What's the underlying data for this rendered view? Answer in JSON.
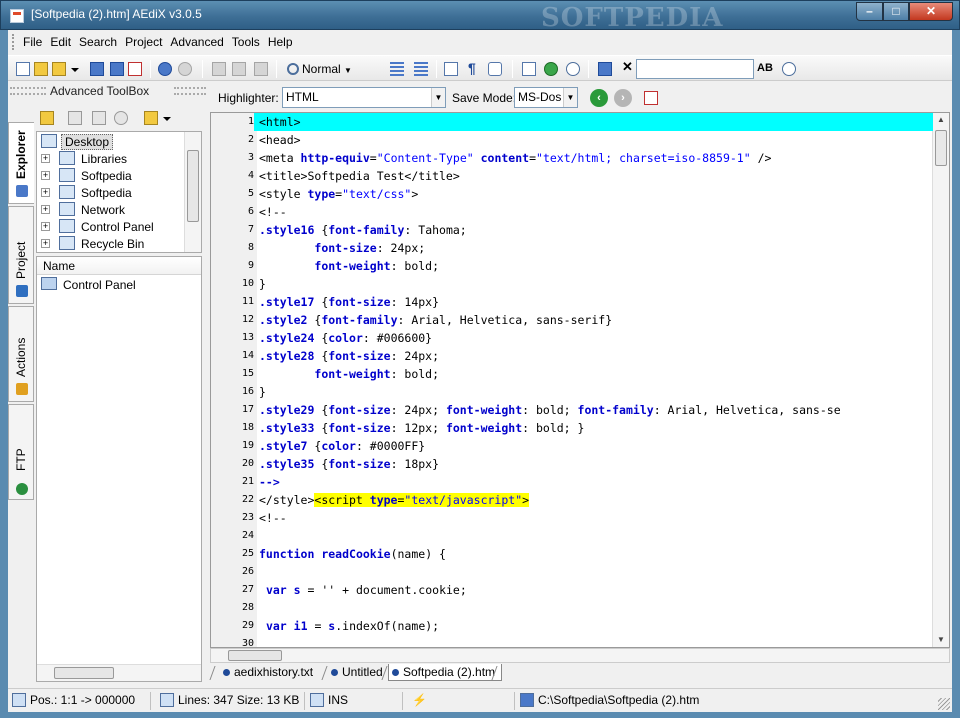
{
  "window": {
    "title": "[Softpedia (2).htm] AEdiX v3.0.5",
    "watermark": "SOFTPEDIA",
    "min_glyph": "–",
    "max_glyph": "□",
    "close_glyph": "✕"
  },
  "menu": [
    "File",
    "Edit",
    "Search",
    "Project",
    "Advanced",
    "Tools",
    "Help"
  ],
  "toolbar": {
    "zoom_label": "Normal",
    "close_glyph": "✕",
    "find_value": "",
    "ab_label": "AB"
  },
  "toolbox": {
    "title": "Advanced ToolBox",
    "tabs": [
      "Explorer",
      "Project",
      "Actions",
      "FTP"
    ],
    "tree": [
      {
        "label": "Desktop",
        "expander": ""
      },
      {
        "label": "Libraries",
        "expander": "+"
      },
      {
        "label": "Softpedia",
        "expander": "+"
      },
      {
        "label": "Softpedia",
        "expander": "+"
      },
      {
        "label": "Network",
        "expander": "+"
      },
      {
        "label": "Control Panel",
        "expander": "+"
      },
      {
        "label": "Recycle Bin",
        "expander": "+"
      }
    ],
    "list_header": "Name",
    "list_items": [
      "Control Panel"
    ]
  },
  "options": {
    "highlighter_label": "Highlighter:",
    "highlighter_value": "HTML",
    "save_mode_label": "Save Mode:",
    "save_mode_value": "MS-Dos"
  },
  "editor": {
    "lines": [
      {
        "n": "1",
        "html": "&lt;html&gt;",
        "current": true
      },
      {
        "n": "2",
        "html": "&lt;head&gt;"
      },
      {
        "n": "3",
        "html": "&lt;meta <span class=\"kw\">http-equiv</span>=<span class=\"str\">\"Content-Type\"</span> <span class=\"kw\">content</span>=<span class=\"str\">\"text/html; charset=iso-8859-1\"</span> /&gt;"
      },
      {
        "n": "4",
        "html": "&lt;title&gt;Softpedia Test&lt;/title&gt;"
      },
      {
        "n": "5",
        "html": "&lt;style <span class=\"kw\">type</span>=<span class=\"str\">\"text/css\"</span>&gt;"
      },
      {
        "n": "6",
        "html": "&lt;!--"
      },
      {
        "n": "7",
        "html": "<span class=\"kw\">.style16</span> {<span class=\"kw\">font-family</span>: Tahoma;"
      },
      {
        "n": "8",
        "html": "        <span class=\"kw\">font-size</span>: 24px;"
      },
      {
        "n": "9",
        "html": "        <span class=\"kw\">font-weight</span>: bold;"
      },
      {
        "n": "10",
        "html": "}"
      },
      {
        "n": "11",
        "html": "<span class=\"kw\">.style17</span> {<span class=\"kw\">font-size</span>: 14px}"
      },
      {
        "n": "12",
        "html": "<span class=\"kw\">.style2</span> {<span class=\"kw\">font-family</span>: Arial, Helvetica, sans-serif}"
      },
      {
        "n": "13",
        "html": "<span class=\"kw\">.style24</span> {<span class=\"kw\">color</span>: #006600}"
      },
      {
        "n": "14",
        "html": "<span class=\"kw\">.style28</span> {<span class=\"kw\">font-size</span>: 24px;"
      },
      {
        "n": "15",
        "html": "        <span class=\"kw\">font-weight</span>: bold;"
      },
      {
        "n": "16",
        "html": "}"
      },
      {
        "n": "17",
        "html": "<span class=\"kw\">.style29</span> {<span class=\"kw\">font-size</span>: 24px; <span class=\"kw\">font-weight</span>: bold; <span class=\"kw\">font-family</span>: Arial, Helvetica, sans-se"
      },
      {
        "n": "18",
        "html": "<span class=\"kw\">.style33</span> {<span class=\"kw\">font-size</span>: 12px; <span class=\"kw\">font-weight</span>: bold; }"
      },
      {
        "n": "19",
        "html": "<span class=\"kw\">.style7</span> {<span class=\"kw\">color</span>: #0000FF}"
      },
      {
        "n": "20",
        "html": "<span class=\"kw\">.style35</span> {<span class=\"kw\">font-size</span>: 18px}"
      },
      {
        "n": "21",
        "html": "<span class=\"kw\">--&gt;</span>"
      },
      {
        "n": "22",
        "html": "&lt;/style&gt;<span class=\"yhl\">&lt;script <span class=\"kw\">type</span>=<span class=\"str\">\"text/javascript\"</span>&gt;</span>"
      },
      {
        "n": "23",
        "html": "&lt;!--"
      },
      {
        "n": "24",
        "html": ""
      },
      {
        "n": "25",
        "html": "<span class=\"kw\">function</span> <span class=\"kw\">readCookie</span>(name) {"
      },
      {
        "n": "26",
        "html": ""
      },
      {
        "n": "27",
        "html": " <span class=\"kw\">var</span> <span class=\"kw\">s</span> = '' + document.cookie;"
      },
      {
        "n": "28",
        "html": ""
      },
      {
        "n": "29",
        "html": " <span class=\"kw\">var</span> <span class=\"kw\">i1</span> = <span class=\"kw\">s</span>.indexOf(name);"
      },
      {
        "n": "30",
        "html": ""
      }
    ]
  },
  "doc_tabs": [
    {
      "label": "aedixhistory.txt",
      "active": false
    },
    {
      "label": "Untitled",
      "active": false
    },
    {
      "label": "Softpedia (2).htm",
      "active": true
    }
  ],
  "status": {
    "pos": "Pos.: 1:1 -> 000000",
    "lines": "Lines: 347 Size: 13 KB",
    "mode": "INS",
    "path": "C:\\Softpedia\\Softpedia (2).htm"
  }
}
